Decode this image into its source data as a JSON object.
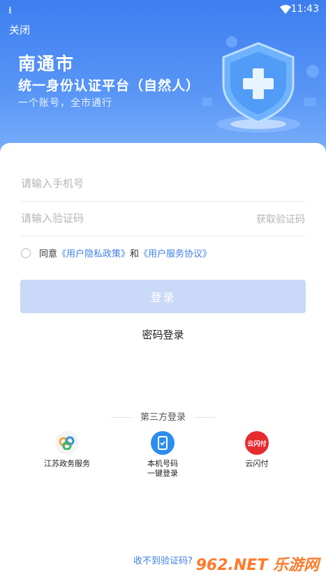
{
  "status": {
    "time": "11:43"
  },
  "header": {
    "close_label": "关闭",
    "city": "南通市",
    "platform": "统一身份认证平台（自然人）",
    "slogan": "一个账号，全市通行"
  },
  "form": {
    "phone_placeholder": "请输入手机号",
    "code_placeholder": "请输入验证码",
    "get_code_label": "获取验证码",
    "agree_prefix": "同意",
    "privacy_link": "《用户隐私政策》",
    "agree_and": "和",
    "service_link": "《用户服务协议》",
    "login_label": "登录",
    "password_login_label": "密码登录"
  },
  "third_party": {
    "title": "第三方登录",
    "providers": [
      {
        "label": "江苏政务服务",
        "icon": "jiangsu-gov-icon"
      },
      {
        "label": "本机号码\n一键登录",
        "icon": "phone-login-icon"
      },
      {
        "label": "云闪付",
        "icon": "unionpay-icon",
        "icon_text": "云闪付"
      }
    ]
  },
  "footer": {
    "no_code_label": "收不到验证码?"
  },
  "watermark": "962.NET 乐游网",
  "colors": {
    "primary": "#3f7fe8",
    "hero": "#4a89f3",
    "login_disabled": "#c9d9f7"
  }
}
